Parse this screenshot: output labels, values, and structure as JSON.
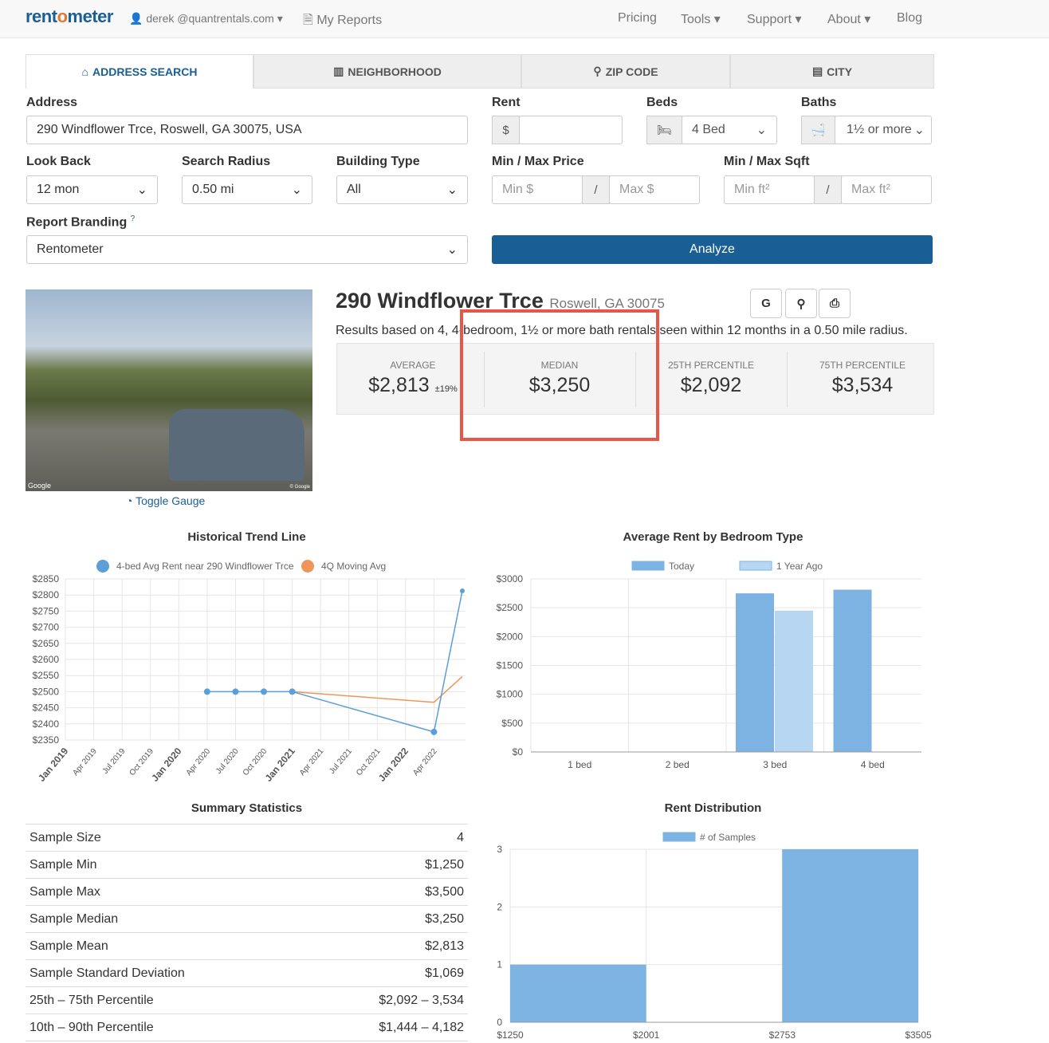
{
  "nav": {
    "logo_a": "rent",
    "logo_b": "o",
    "logo_c": "meter",
    "user": "derek @quantrentals.com",
    "reports": "My Reports",
    "links": [
      "Pricing",
      "Tools",
      "Support",
      "About",
      "Blog"
    ]
  },
  "tabs": [
    {
      "label": "ADDRESS SEARCH",
      "icon": "home-icon"
    },
    {
      "label": "NEIGHBORHOOD",
      "icon": "building-icon"
    },
    {
      "label": "ZIP CODE",
      "icon": "map-marker-icon"
    },
    {
      "label": "CITY",
      "icon": "city-icon"
    }
  ],
  "form": {
    "address_label": "Address",
    "address_value": "290 Windflower Trce, Roswell, GA 30075, USA",
    "rent_label": "Rent",
    "rent_addon": "$",
    "rent_value": "",
    "beds_label": "Beds",
    "beds_value": "4 Bed",
    "baths_label": "Baths",
    "baths_value": "1½ or more",
    "lookback_label": "Look Back",
    "lookback_value": "12 mon",
    "radius_label": "Search Radius",
    "radius_value": "0.50 mi",
    "building_label": "Building Type",
    "building_value": "All",
    "price_label": "Min / Max Price",
    "min_price_ph": "Min $",
    "max_price_ph": "Max $",
    "sqft_label": "Min / Max Sqft",
    "min_sqft_ph": "Min ft²",
    "max_sqft_ph": "Max ft²",
    "slash": "/",
    "branding_label": "Report Branding",
    "branding_value": "Rentometer",
    "analyze": "Analyze"
  },
  "result": {
    "title": "290 Windflower Trce",
    "subtitle": "Roswell, GA 30075",
    "summary": "Results based on 4, 4-bedroom, 1½ or more bath rentals seen within 12 months in a 0.50 mile radius.",
    "buttons": [
      "G",
      "⚲",
      "⎙"
    ],
    "toggle_gauge": "Toggle Gauge",
    "photo_credit": "Google",
    "photo_copy": "© Google",
    "stats": [
      {
        "label": "AVERAGE",
        "value": "$2,813",
        "extra": "±19%"
      },
      {
        "label": "MEDIAN",
        "value": "$3,250",
        "extra": ""
      },
      {
        "label": "25TH PERCENTILE",
        "value": "$2,092",
        "extra": ""
      },
      {
        "label": "75TH PERCENTILE",
        "value": "$3,534",
        "extra": ""
      }
    ],
    "highlight_color": "#e8564a"
  },
  "summary_stats": {
    "title": "Summary Statistics",
    "rows": [
      [
        "Sample Size",
        "4"
      ],
      [
        "Sample Min",
        "$1,250"
      ],
      [
        "Sample Max",
        "$3,500"
      ],
      [
        "Sample Median",
        "$3,250"
      ],
      [
        "Sample Mean",
        "$2,813"
      ],
      [
        "Sample Standard Deviation",
        "$1,069"
      ],
      [
        "25th – 75th Percentile",
        "$2,092 – 3,534"
      ],
      [
        "10th – 90th Percentile",
        "$1,444 – 4,182"
      ]
    ]
  },
  "chart_data": [
    {
      "type": "line",
      "title": "Historical Trend Line",
      "ylim": [
        2350,
        2850
      ],
      "yticks": [
        "$2850",
        "$2800",
        "$2750",
        "$2700",
        "$2650",
        "$2600",
        "$2550",
        "$2500",
        "$2450",
        "$2400",
        "$2350"
      ],
      "xticks": [
        "Jan 2019",
        "Apr 2019",
        "Jul 2019",
        "Oct 2019",
        "Jan 2020",
        "Apr 2020",
        "Jul 2020",
        "Oct 2020",
        "Jan 2021",
        "Apr 2021",
        "Jul 2021",
        "Oct 2021",
        "Jan 2022",
        "Apr 2022"
      ],
      "legend": "top",
      "grid": true,
      "series": [
        {
          "name": "4-bed Avg Rent near 290 Windflower Trce",
          "color": "#5a9fd8",
          "x": [
            "2020-04",
            "2020-07",
            "2020-10",
            "2021-01",
            "2022-04",
            "2022-07"
          ],
          "y": [
            2500,
            2500,
            2500,
            2500,
            2375,
            2813
          ]
        },
        {
          "name": "4Q Moving Avg",
          "color": "#f0955a",
          "x": [
            "2021-01",
            "2022-04",
            "2022-07"
          ],
          "y": [
            2500,
            2467,
            2547
          ]
        }
      ]
    },
    {
      "type": "bar",
      "title": "Average Rent by Bedroom Type",
      "categories": [
        "1 bed",
        "2 bed",
        "3 bed",
        "4 bed"
      ],
      "ylim": [
        0,
        3000
      ],
      "yticks": [
        "$3000",
        "$2500",
        "$2000",
        "$1500",
        "$1000",
        "$500",
        "$0"
      ],
      "legend": "top",
      "series": [
        {
          "name": "Today",
          "color": "#7db3e2",
          "values": [
            0,
            0,
            2750,
            2813
          ]
        },
        {
          "name": "1 Year Ago",
          "color": "#b7d6f2",
          "values": [
            0,
            0,
            2450,
            0
          ]
        }
      ]
    },
    {
      "type": "bar",
      "title": "Rent Distribution",
      "categories": [
        "$1250",
        "$2001",
        "$2753",
        "$3505"
      ],
      "ylim": [
        0,
        3
      ],
      "yticks": [
        "3",
        "2",
        "1",
        "0"
      ],
      "legend": "top",
      "series": [
        {
          "name": "# of Samples",
          "color": "#7db3e2",
          "values": [
            1,
            0,
            3
          ]
        }
      ]
    }
  ]
}
